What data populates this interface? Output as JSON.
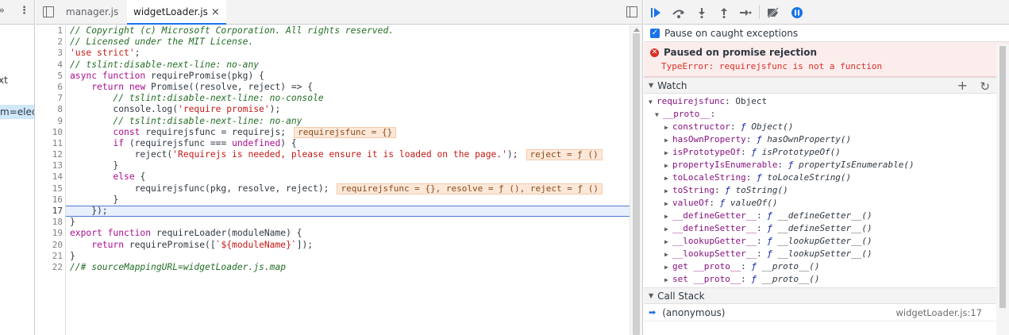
{
  "left_panel": {
    "fragment_1": "xt",
    "fragment_2": "m=electr"
  },
  "tabs": [
    {
      "label": "manager.js",
      "active": false
    },
    {
      "label": "widgetLoader.js",
      "active": true,
      "close": "×"
    }
  ],
  "code": {
    "current_line": 17,
    "lines": [
      {
        "n": "1",
        "text": "// Copyright (c) Microsoft Corporation. All rights reserved."
      },
      {
        "n": "2",
        "text": "// Licensed under the MIT License."
      },
      {
        "n": "3",
        "text": "'use strict';"
      },
      {
        "n": "4",
        "text": "// tslint:disable-next-line: no-any"
      },
      {
        "n": "5",
        "text": "async function requirePromise(pkg) {"
      },
      {
        "n": "6",
        "text": "    return new Promise((resolve, reject) => {"
      },
      {
        "n": "7",
        "text": "        // tslint:disable-next-line: no-console"
      },
      {
        "n": "8",
        "text": "        console.log('require promise');"
      },
      {
        "n": "9",
        "text": "        // tslint:disable-next-line: no-any"
      },
      {
        "n": "10",
        "text": "        const requirejsfunc = requirejs;",
        "inline": "requirejsfunc = {}"
      },
      {
        "n": "11",
        "text": "        if (requirejsfunc === undefined) {"
      },
      {
        "n": "12",
        "text": "            reject('Requirejs is needed, please ensure it is loaded on the page.');",
        "inline": "reject = ƒ ()"
      },
      {
        "n": "13",
        "text": "        }"
      },
      {
        "n": "14",
        "text": "        else {"
      },
      {
        "n": "15",
        "text": "            requirejsfunc(pkg, resolve, reject);",
        "inline": "requirejsfunc = {}, resolve = ƒ (), reject = ƒ ()"
      },
      {
        "n": "16",
        "text": "        }"
      },
      {
        "n": "17",
        "text": "    });"
      },
      {
        "n": "18",
        "text": "}"
      },
      {
        "n": "19",
        "text": "export function requireLoader(moduleName) {"
      },
      {
        "n": "20",
        "text": "    return requirePromise([`${moduleName}`]);"
      },
      {
        "n": "21",
        "text": "}"
      },
      {
        "n": "22",
        "text": "//# sourceMappingURL=widgetLoader.js.map"
      }
    ]
  },
  "debugger": {
    "pause_on_caught_label": "Pause on caught exceptions",
    "pause_on_caught_checked": true,
    "paused_title": "Paused on promise rejection",
    "paused_detail": "TypeError: requirejsfunc is not a function",
    "watch_label": "Watch",
    "watch_root": {
      "name": "requirejsfunc",
      "value": "Object"
    },
    "proto_label": "__proto__",
    "proto_items": [
      {
        "name": "constructor",
        "sig": "Object()"
      },
      {
        "name": "hasOwnProperty",
        "sig": "hasOwnProperty()"
      },
      {
        "name": "isPrototypeOf",
        "sig": "isPrototypeOf()"
      },
      {
        "name": "propertyIsEnumerable",
        "sig": "propertyIsEnumerable()"
      },
      {
        "name": "toLocaleString",
        "sig": "toLocaleString()"
      },
      {
        "name": "toString",
        "sig": "toString()"
      },
      {
        "name": "valueOf",
        "sig": "valueOf()"
      },
      {
        "name": "__defineGetter__",
        "sig": "__defineGetter__()"
      },
      {
        "name": "__defineSetter__",
        "sig": "__defineSetter__()"
      },
      {
        "name": "__lookupGetter__",
        "sig": "__lookupGetter__()"
      },
      {
        "name": "__lookupSetter__",
        "sig": "__lookupSetter__()"
      },
      {
        "name": "get __proto__",
        "sig": "__proto__()"
      },
      {
        "name": "set __proto__",
        "sig": "__proto__()"
      }
    ],
    "call_stack_label": "Call Stack",
    "call_stack": [
      {
        "name": "(anonymous)",
        "location": "widgetLoader.js:17"
      }
    ]
  }
}
